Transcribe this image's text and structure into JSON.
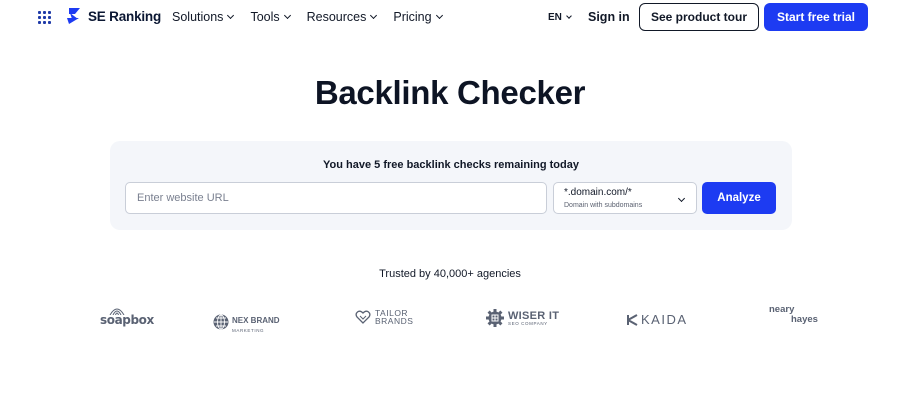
{
  "header": {
    "brand": "SE Ranking",
    "nav": [
      "Solutions",
      "Tools",
      "Resources",
      "Pricing"
    ],
    "language": "EN",
    "signin_label": "Sign in",
    "tour_label": "See product tour",
    "trial_label": "Start free trial",
    "accent_color": "#1d3bf2"
  },
  "main": {
    "title": "Backlink Checker",
    "remaining_text": "You have 5 free backlink checks remaining today",
    "url_placeholder": "Enter website URL",
    "url_value": "",
    "scope_value": "*.domain.com/*",
    "scope_sub": "Domain with subdomains",
    "analyze_label": "Analyze"
  },
  "trusted": {
    "text": "Trusted by 40,000+ agencies",
    "logos": [
      {
        "name": "soapbox",
        "text": "soapbox"
      },
      {
        "name": "nex-brand",
        "text": "NEX BRAND",
        "sub": "MARKETING"
      },
      {
        "name": "tailor-brands",
        "text1": "TAILOR",
        "text2": "BRANDS"
      },
      {
        "name": "wiser-it",
        "text": "WISER IT",
        "sub": "SEO COMPANY"
      },
      {
        "name": "kaida",
        "text": "KAIDA"
      },
      {
        "name": "neary-hayes",
        "text1": "neary",
        "text2": "hayes"
      }
    ]
  }
}
